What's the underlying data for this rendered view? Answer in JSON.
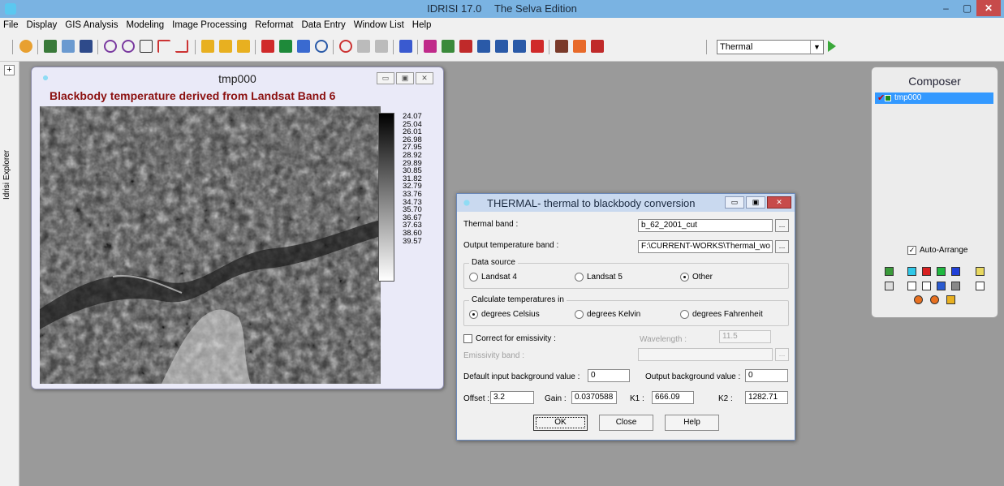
{
  "app": {
    "title": "IDRISI 17.0",
    "edition": "The Selva Edition",
    "minimize": "–",
    "maximize": "▢",
    "close": "✕"
  },
  "menu": [
    "File",
    "Display",
    "GIS Analysis",
    "Modeling",
    "Image Processing",
    "Reformat",
    "Data Entry",
    "Window List",
    "Help"
  ],
  "toolbar": {
    "layer_select_value": "Thermal"
  },
  "explorer": {
    "label": "Idrisi Explorer",
    "expand": "+"
  },
  "map_window": {
    "title": "tmp000",
    "heading": "Blackbody temperature derived from Landsat Band 6",
    "legend_values": [
      "24.07",
      "25.04",
      "26.01",
      "26.98",
      "27.95",
      "28.92",
      "29.89",
      "30.85",
      "31.82",
      "32.79",
      "33.76",
      "34.73",
      "35.70",
      "36.67",
      "37.63",
      "38.60",
      "39.57"
    ]
  },
  "composer": {
    "title": "Composer",
    "layer": "tmp000",
    "auto_arrange_label": "Auto-Arrange",
    "auto_arrange_checked": "✓"
  },
  "dialog": {
    "title": "THERMAL- thermal to blackbody conversion",
    "thermal_band_label": "Thermal band :",
    "thermal_band_value": "b_62_2001_cut",
    "output_band_label": "Output temperature band :",
    "output_band_value": "F:\\CURRENT-WORKS\\Thermal_wo",
    "browse": "...",
    "data_source": {
      "legend": "Data source",
      "options": [
        "Landsat 4",
        "Landsat 5",
        "Other"
      ],
      "selected": "Other"
    },
    "temperatures": {
      "legend": "Calculate temperatures in",
      "options": [
        "degrees Celsius",
        "degrees Kelvin",
        "degrees Fahrenheit"
      ],
      "selected": "degrees Celsius"
    },
    "correct_emissivity_label": "Correct for emissivity :",
    "wavelength_label": "Wavelength :",
    "wavelength_value": "11.5",
    "emissivity_band_label": "Emissivity band :",
    "default_input_bg_label": "Default input background value :",
    "default_input_bg_value": "0",
    "output_bg_label": "Output background value :",
    "output_bg_value": "0",
    "offset_label": "Offset :",
    "offset_value": "3.2",
    "gain_label": "Gain :",
    "gain_value": "0.0370588",
    "k1_label": "K1 :",
    "k1_value": "666.09",
    "k2_label": "K2 :",
    "k2_value": "1282.71",
    "ok_label": "OK",
    "close_label": "Close",
    "help_label": "Help"
  }
}
